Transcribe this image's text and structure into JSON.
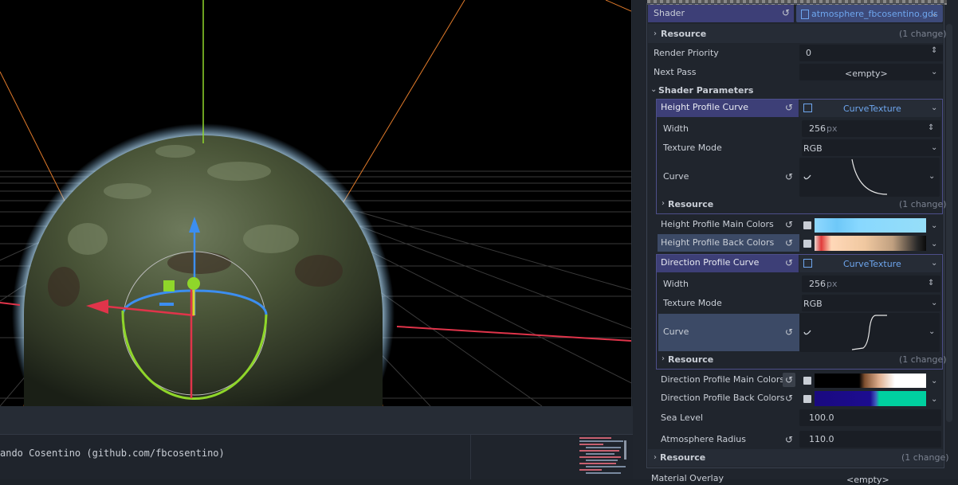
{
  "viewport": {},
  "script": {
    "code_line": "ando Cosentino (github.com/fbcosentino)"
  },
  "inspector": {
    "shader": {
      "label": "Shader",
      "value": "atmosphere_fbcosentino.gds"
    },
    "resource1": {
      "label": "Resource",
      "change": "(1 change)"
    },
    "render_priority": {
      "label": "Render Priority",
      "value": "0"
    },
    "next_pass": {
      "label": "Next Pass",
      "value": "<empty>"
    },
    "shader_params": {
      "label": "Shader Parameters"
    },
    "height_curve": {
      "label": "Height Profile Curve",
      "value": "CurveTexture",
      "width_label": "Width",
      "width_value": "256",
      "width_unit": "px",
      "texture_mode_label": "Texture Mode",
      "texture_mode_value": "RGB",
      "curve_label": "Curve",
      "resource_label": "Resource",
      "resource_change": "(1 change)"
    },
    "height_main_colors": {
      "label": "Height Profile Main Colors"
    },
    "height_back_colors": {
      "label": "Height Profile Back Colors"
    },
    "direction_curve": {
      "label": "Direction Profile Curve",
      "value": "CurveTexture",
      "width_label": "Width",
      "width_value": "256",
      "width_unit": "px",
      "texture_mode_label": "Texture Mode",
      "texture_mode_value": "RGB",
      "curve_label": "Curve",
      "resource_label": "Resource",
      "resource_change": "(1 change)"
    },
    "direction_main_colors": {
      "label": "Direction Profile Main Colors"
    },
    "direction_back_colors": {
      "label": "Direction Profile Back Colors"
    },
    "sea_level": {
      "label": "Sea Level",
      "value": "100.0"
    },
    "atmosphere_radius": {
      "label": "Atmosphere Radius",
      "value": "110.0"
    },
    "resource_bottom": {
      "label": "Resource",
      "change": "(1 change)"
    },
    "material_overlay": {
      "label": "Material Overlay",
      "value": "<empty>"
    }
  },
  "colors": {
    "accent": "#6ea6ee",
    "header_purple": "#3d3f77",
    "panel": "#20252d"
  }
}
